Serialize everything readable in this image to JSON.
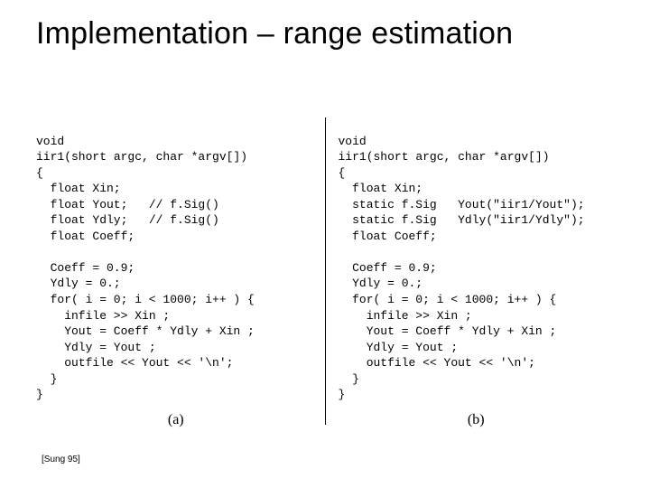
{
  "title": "Implementation – range estimation",
  "citation": "[Sung 95]",
  "figure": {
    "label_a": "(a)",
    "label_b": "(b)",
    "a": {
      "l01": "void",
      "l02": "iir1(short argc, char *argv[])",
      "l03": "{",
      "l04": "float Xin;",
      "l05": "float Yout;",
      "l05c": "// f.Sig()",
      "l06": "float Ydly;",
      "l06c": "// f.Sig()",
      "l07": "float Coeff;",
      "l08": "",
      "l09": "Coeff = 0.9;",
      "l10": "Ydly = 0.;",
      "l11": "for( i = 0; i < 1000; i++ ) {",
      "l12": "infile >> Xin ;",
      "l13": "Yout = Coeff * Ydly + Xin ;",
      "l14": "Ydly = Yout ;",
      "l15": "outfile << Yout << '\\n';",
      "l16": "}",
      "l17": "}"
    },
    "b": {
      "l01": "void",
      "l02": "iir1(short argc, char *argv[])",
      "l03": "{",
      "l04": "float Xin;",
      "l05": "static f.Sig",
      "l05v": "Yout(\"iir1/Yout\");",
      "l06": "static f.Sig",
      "l06v": "Ydly(\"iir1/Ydly\");",
      "l07": "float Coeff;",
      "l08": "",
      "l09": "Coeff = 0.9;",
      "l10": "Ydly = 0.;",
      "l11": "for( i = 0; i < 1000; i++ ) {",
      "l12": "infile >> Xin ;",
      "l13": "Yout = Coeff * Ydly + Xin ;",
      "l14": "Ydly = Yout ;",
      "l15": "outfile << Yout << '\\n';",
      "l16": "}",
      "l17": "}"
    }
  }
}
